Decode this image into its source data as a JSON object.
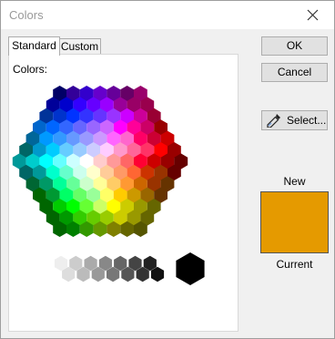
{
  "window": {
    "title": "Colors"
  },
  "tabs": [
    {
      "label": "Standard",
      "active": true
    },
    {
      "label": "Custom",
      "active": false
    }
  ],
  "panel": {
    "colors_label": "Colors:"
  },
  "buttons": {
    "ok": "OK",
    "cancel": "Cancel",
    "select": "Select..."
  },
  "preview": {
    "new_label": "New",
    "current_label": "Current",
    "new_color": "#e59a00",
    "current_color": "#e59a00"
  },
  "palette": {
    "hex_rows": [
      [
        "#000066",
        "#330099",
        "#3300cc",
        "#6600cc",
        "#660099",
        "#660066",
        "#99006b"
      ],
      [
        "#000099",
        "#0000cc",
        "#3300ff",
        "#6600ff",
        "#9900ff",
        "#990099",
        "#990066",
        "#99004d"
      ],
      [
        "#003399",
        "#0033cc",
        "#0033ff",
        "#3333ff",
        "#6633ff",
        "#9933ff",
        "#cc00ff",
        "#cc0099",
        "#990033"
      ],
      [
        "#0066cc",
        "#0066ff",
        "#3366ff",
        "#6666ff",
        "#9966ff",
        "#cc66ff",
        "#ff00ff",
        "#ff0099",
        "#cc0066",
        "#990000"
      ],
      [
        "#006699",
        "#0099ff",
        "#3399ff",
        "#6699ff",
        "#9999ff",
        "#cc99ff",
        "#ff66ff",
        "#ff66cc",
        "#ff0066",
        "#cc0033",
        "#cc0000"
      ],
      [
        "#006666",
        "#0099cc",
        "#00ccff",
        "#66ccff",
        "#99ccff",
        "#ccccff",
        "#ffccff",
        "#ff99cc",
        "#ff6699",
        "#ff3366",
        "#ff0000",
        "#990000"
      ],
      [
        "#009999",
        "#00cccc",
        "#00ffff",
        "#66ffff",
        "#ccffff",
        "#ffffff",
        "#ffcccc",
        "#ff9999",
        "#ff6666",
        "#ff0033",
        "#cc0000",
        "#990000",
        "#660000"
      ],
      [
        "#006666",
        "#009999",
        "#00ffcc",
        "#66ffcc",
        "#ccffee",
        "#ffffcc",
        "#ffcc99",
        "#ff9966",
        "#ff6633",
        "#cc3300",
        "#993300",
        "#660000"
      ],
      [
        "#006633",
        "#009966",
        "#00ff99",
        "#66ff99",
        "#ccffcc",
        "#ffff99",
        "#ffcc66",
        "#ff9933",
        "#cc6600",
        "#993300",
        "#663300"
      ],
      [
        "#006600",
        "#009933",
        "#00ff66",
        "#66ff66",
        "#99ff99",
        "#ffff66",
        "#ffcc00",
        "#cc9900",
        "#996600",
        "#663300"
      ],
      [
        "#006600",
        "#00cc00",
        "#00ff00",
        "#66ff33",
        "#ccff66",
        "#ffff00",
        "#cccc00",
        "#999900",
        "#666600"
      ],
      [
        "#006600",
        "#009900",
        "#33cc00",
        "#66cc00",
        "#99cc00",
        "#cccc00",
        "#999900",
        "#666600"
      ],
      [
        "#006600",
        "#008000",
        "#339900",
        "#669900",
        "#808000",
        "#666600",
        "#555500"
      ]
    ],
    "gray_tops": [
      "#eeeeee",
      "#cccccc",
      "#aaaaaa",
      "#888888",
      "#666666",
      "#444444",
      "#222222"
    ],
    "gray_bottoms": [
      "#dddddd",
      "#bbbbbb",
      "#999999",
      "#777777",
      "#555555",
      "#333333",
      "#111111"
    ],
    "black_cell": "#000000"
  }
}
